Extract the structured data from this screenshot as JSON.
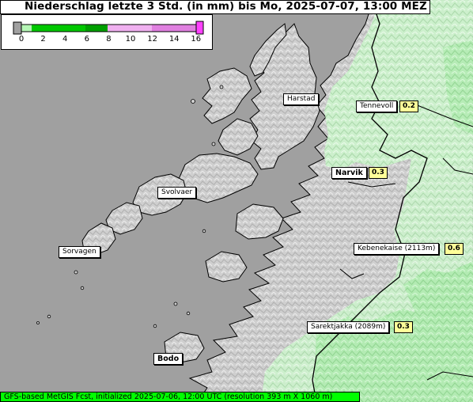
{
  "header": {
    "title": "Niederschlag letzte 3 Std. (in mm) bis Mo, 2025-07-07, 13:00 MEZ"
  },
  "legend": {
    "tick_labels": [
      "0",
      "2",
      "4",
      "6",
      "8",
      "10",
      "12",
      "14",
      "16"
    ],
    "colors": {
      "below_min": "#a0a0a0",
      "light_green": "#b6f7b6",
      "green": "#00c800",
      "dark_green": "#00a000",
      "pink_light": "#f0b0f0",
      "pink": "#e080e0",
      "magenta": "#ff40ff"
    }
  },
  "places": [
    {
      "name": "Harstad",
      "value": null,
      "bold": false
    },
    {
      "name": "Tennevoll",
      "value": "0.2",
      "bold": false
    },
    {
      "name": "Narvik",
      "value": "0.3",
      "bold": true
    },
    {
      "name": "Svolvaer",
      "value": null,
      "bold": false
    },
    {
      "name": "Sorvagen",
      "value": null,
      "bold": false
    },
    {
      "name": "Kebenekaise (2113m)",
      "value": "0.6",
      "bold": false
    },
    {
      "name": "Sarektjakka (2089m)",
      "value": "0.3",
      "bold": false
    },
    {
      "name": "Bodo",
      "value": null,
      "bold": true
    }
  ],
  "footer": {
    "text": "GFS-based MetGIS Fcst, initialized 2025-07-06, 12:00 UTC  (resolution 393 m X 1060 m)"
  },
  "map_colors": {
    "sea": "#a0a0a0",
    "land": "#d2d2d2",
    "precip_light": "#c8f5c8",
    "precip_mid": "#a6eda6",
    "coast": "#000000"
  }
}
